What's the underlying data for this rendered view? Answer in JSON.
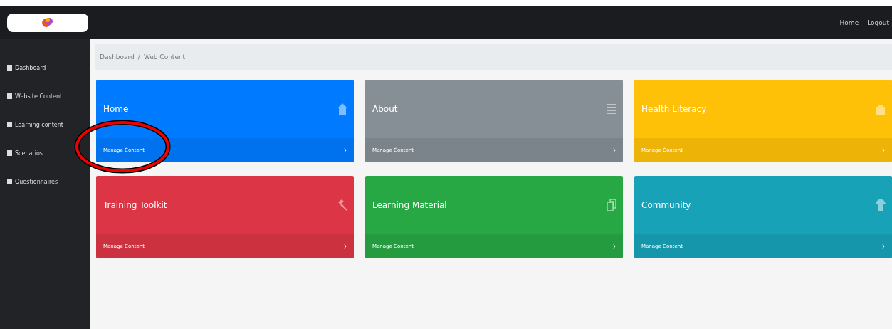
{
  "topbar": {
    "links": [
      "Home",
      "Logout"
    ]
  },
  "sidebar": {
    "items": [
      {
        "label": "Dashboard"
      },
      {
        "label": "Website Content"
      },
      {
        "label": "Learning content"
      },
      {
        "label": "Scenarios"
      },
      {
        "label": "Questionnaires"
      }
    ]
  },
  "breadcrumb": {
    "items": [
      "Dashboard",
      "Web Content"
    ],
    "separator": "/"
  },
  "cards": [
    {
      "title": "Home",
      "link": "Manage Content",
      "color": "#007bff"
    },
    {
      "title": "About",
      "link": "Manage Content",
      "color": "#868e96"
    },
    {
      "title": "Health Literacy",
      "link": "Manage Content",
      "color": "#ffc107"
    },
    {
      "title": "Training Toolkit",
      "link": "Manage Content",
      "color": "#dc3545"
    },
    {
      "title": "Learning Material",
      "link": "Manage Content",
      "color": "#28a745"
    },
    {
      "title": "Community",
      "link": "Manage Content",
      "color": "#17a2b8"
    }
  ]
}
